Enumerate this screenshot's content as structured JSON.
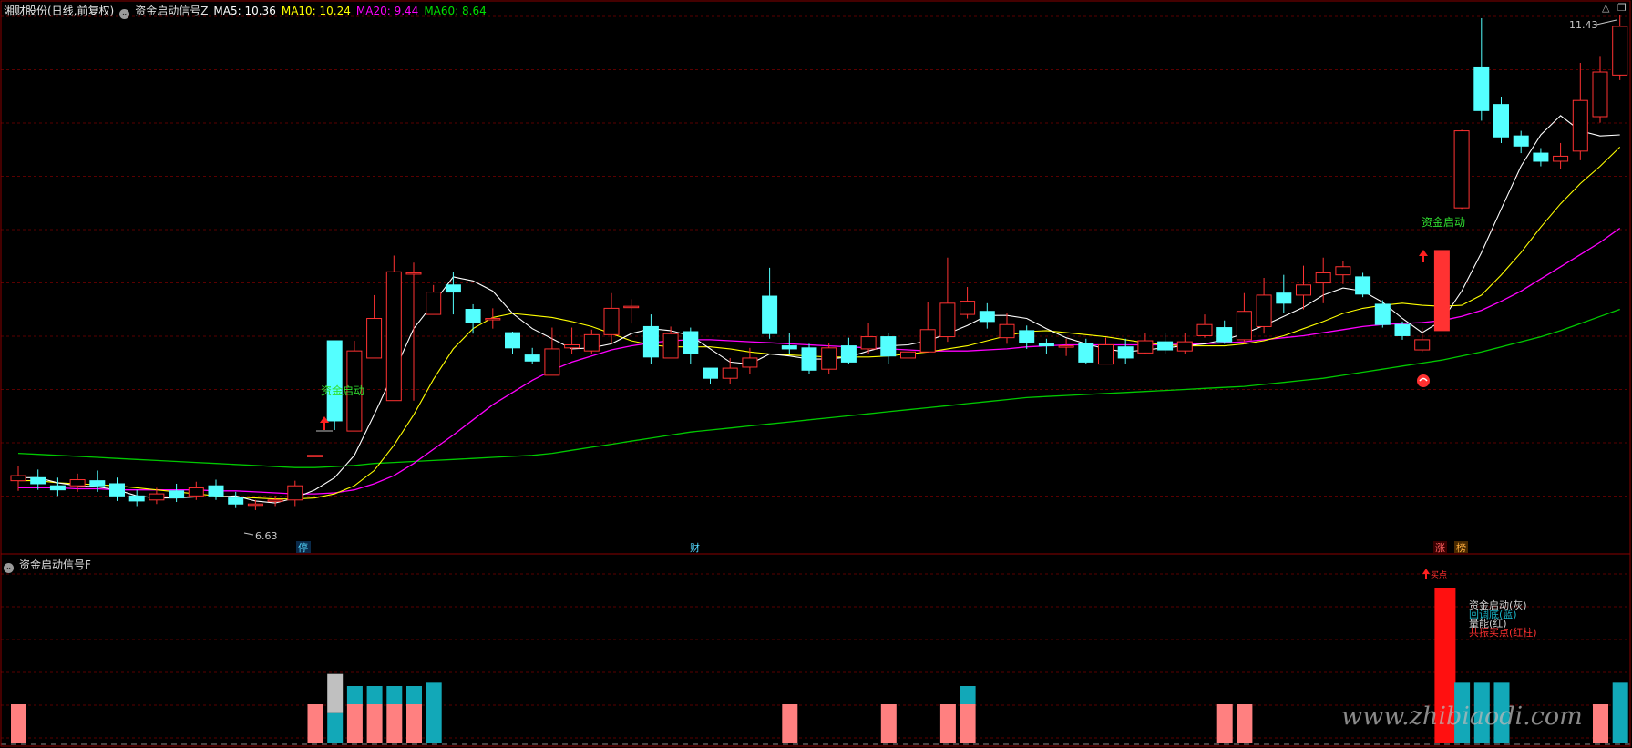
{
  "main_header": {
    "stock": "湘财股份(日线,前复权)",
    "indicator": "资金启动信号Z",
    "ma5": "MA5: 10.36",
    "ma10": "MA10: 10.24",
    "ma20": "MA20: 9.44",
    "ma60": "MA60: 8.64"
  },
  "sub_header": {
    "indicator": "资金启动信号F"
  },
  "price_labels": {
    "high": "11.43",
    "low": "6.63"
  },
  "markers": {
    "start_signal_1": "资金启动",
    "start_signal_2": "资金启动",
    "ting": "停",
    "cai": "财",
    "zhang": "涨",
    "bang": "榜",
    "buy_label": "买点"
  },
  "legend": [
    {
      "text": "资金启动(灰)",
      "color": "#d0d0d0"
    },
    {
      "text": "回调底(蓝)",
      "color": "#19b5c8"
    },
    {
      "text": "量能(红)",
      "color": "#d0d0d0"
    },
    {
      "text": "共振买点(红柱)",
      "color": "#ff3030"
    }
  ],
  "watermark": "www.zhibiaodi.com",
  "colors": {
    "up": "#ff3232",
    "down": "#54ffff",
    "ma5": "#ffffff",
    "ma10": "#ffff00",
    "ma20": "#ff00ff",
    "ma60": "#00c800",
    "grid": "#5a0000",
    "pink_bar": "#ff8080",
    "teal_bar": "#12a8b8",
    "gray_bar": "#c0c0c0"
  },
  "chart_data": {
    "type": "candlestick",
    "price_range": [
      6.3,
      11.6
    ],
    "candles": [
      [
        6.95,
        7.0,
        7.1,
        6.85
      ],
      [
        6.98,
        6.92,
        7.06,
        6.86
      ],
      [
        6.9,
        6.86,
        6.98,
        6.8
      ],
      [
        6.9,
        6.96,
        7.02,
        6.84
      ],
      [
        6.95,
        6.9,
        7.05,
        6.84
      ],
      [
        6.92,
        6.8,
        6.98,
        6.75
      ],
      [
        6.8,
        6.75,
        6.86,
        6.7
      ],
      [
        6.76,
        6.82,
        6.88,
        6.72
      ],
      [
        6.85,
        6.78,
        6.92,
        6.74
      ],
      [
        6.8,
        6.88,
        6.94,
        6.76
      ],
      [
        6.9,
        6.8,
        6.96,
        6.76
      ],
      [
        6.78,
        6.72,
        6.84,
        6.68
      ],
      [
        6.72,
        6.72,
        6.76,
        6.66
      ],
      [
        6.75,
        6.76,
        6.8,
        6.7
      ],
      [
        6.76,
        6.9,
        6.95,
        6.7
      ],
      [
        7.2,
        7.2,
        7.2,
        7.2
      ],
      [
        8.33,
        7.54,
        8.33,
        7.45
      ],
      [
        7.44,
        8.23,
        8.33,
        7.44
      ],
      [
        8.16,
        8.55,
        8.78,
        8.16
      ],
      [
        7.74,
        9.01,
        9.17,
        7.74
      ],
      [
        9.0,
        9.0,
        9.1,
        7.74
      ],
      [
        8.59,
        8.81,
        8.88,
        8.59
      ],
      [
        8.88,
        8.81,
        9.01,
        8.59
      ],
      [
        8.64,
        8.51,
        8.69,
        8.4
      ],
      [
        8.55,
        8.55,
        8.65,
        8.45
      ],
      [
        8.41,
        8.26,
        8.42,
        8.2
      ],
      [
        8.19,
        8.13,
        8.26,
        8.1
      ],
      [
        7.99,
        8.25,
        8.46,
        7.99
      ],
      [
        8.26,
        8.29,
        8.46,
        8.2
      ],
      [
        8.23,
        8.39,
        8.44,
        8.2
      ],
      [
        8.39,
        8.65,
        8.8,
        8.3
      ],
      [
        8.67,
        8.67,
        8.74,
        8.5
      ],
      [
        8.47,
        8.17,
        8.59,
        8.1
      ],
      [
        8.16,
        8.4,
        8.47,
        8.16
      ],
      [
        8.42,
        8.2,
        8.46,
        8.1
      ],
      [
        8.06,
        7.96,
        8.06,
        7.9
      ],
      [
        7.96,
        8.06,
        8.16,
        7.9
      ],
      [
        8.07,
        8.16,
        8.26,
        8.0
      ],
      [
        8.77,
        8.4,
        9.05,
        8.35
      ],
      [
        8.28,
        8.25,
        8.41,
        8.2
      ],
      [
        8.26,
        8.04,
        8.3,
        8.0
      ],
      [
        8.05,
        8.26,
        8.31,
        8.0
      ],
      [
        8.28,
        8.12,
        8.36,
        8.1
      ],
      [
        8.25,
        8.37,
        8.51,
        8.2
      ],
      [
        8.37,
        8.18,
        8.41,
        8.1
      ],
      [
        8.16,
        8.22,
        8.28,
        8.12
      ],
      [
        8.22,
        8.44,
        8.71,
        8.22
      ],
      [
        8.37,
        8.7,
        9.15,
        8.32
      ],
      [
        8.59,
        8.72,
        8.86,
        8.55
      ],
      [
        8.62,
        8.52,
        8.7,
        8.45
      ],
      [
        8.36,
        8.49,
        8.6,
        8.3
      ],
      [
        8.43,
        8.31,
        8.48,
        8.25
      ],
      [
        8.3,
        8.28,
        8.35,
        8.2
      ],
      [
        8.28,
        8.28,
        8.35,
        8.18
      ],
      [
        8.3,
        8.12,
        8.35,
        8.1
      ],
      [
        8.1,
        8.29,
        8.36,
        8.1
      ],
      [
        8.27,
        8.16,
        8.35,
        8.1
      ],
      [
        8.21,
        8.33,
        8.41,
        8.2
      ],
      [
        8.32,
        8.24,
        8.41,
        8.2
      ],
      [
        8.23,
        8.32,
        8.41,
        8.2
      ],
      [
        8.38,
        8.49,
        8.59,
        8.36
      ],
      [
        8.46,
        8.32,
        8.53,
        8.3
      ],
      [
        8.34,
        8.62,
        8.8,
        8.3
      ],
      [
        8.47,
        8.78,
        8.95,
        8.4
      ],
      [
        8.8,
        8.7,
        8.98,
        8.6
      ],
      [
        8.78,
        8.88,
        9.07,
        8.64
      ],
      [
        8.9,
        9.0,
        9.15,
        8.7
      ],
      [
        8.98,
        9.06,
        9.12,
        8.89
      ],
      [
        8.96,
        8.79,
        9.0,
        8.76
      ],
      [
        8.69,
        8.49,
        8.73,
        8.46
      ],
      [
        8.49,
        8.38,
        8.52,
        8.34
      ],
      [
        8.24,
        8.34,
        8.46,
        8.22
      ],
      [
        8.43,
        9.22,
        9.22,
        8.43
      ],
      [
        9.64,
        10.4,
        10.41,
        9.63
      ],
      [
        11.03,
        10.6,
        11.51,
        10.5
      ],
      [
        10.66,
        10.34,
        10.73,
        10.28
      ],
      [
        10.35,
        10.25,
        10.4,
        10.18
      ],
      [
        10.18,
        10.1,
        10.23,
        10.05
      ],
      [
        10.1,
        10.15,
        10.28,
        10.02
      ],
      [
        10.2,
        10.7,
        11.07,
        10.11
      ],
      [
        10.54,
        10.98,
        11.13,
        10.48
      ],
      [
        10.95,
        11.43,
        11.54,
        10.9
      ]
    ],
    "ma5": [
      6.98,
      6.98,
      6.93,
      6.9,
      6.89,
      6.86,
      6.8,
      6.78,
      6.78,
      6.79,
      6.79,
      6.8,
      6.75,
      6.73,
      6.78,
      6.86,
      6.98,
      7.2,
      7.6,
      8.02,
      8.45,
      8.7,
      8.96,
      8.92,
      8.82,
      8.6,
      8.45,
      8.35,
      8.25,
      8.26,
      8.3,
      8.4,
      8.45,
      8.43,
      8.38,
      8.25,
      8.12,
      8.1,
      8.2,
      8.18,
      8.15,
      8.15,
      8.17,
      8.23,
      8.28,
      8.29,
      8.33,
      8.4,
      8.48,
      8.58,
      8.58,
      8.55,
      8.45,
      8.36,
      8.3,
      8.25,
      8.22,
      8.24,
      8.26,
      8.28,
      8.3,
      8.34,
      8.4,
      8.48,
      8.57,
      8.66,
      8.78,
      8.85,
      8.82,
      8.71,
      8.55,
      8.41,
      8.53,
      8.82,
      9.2,
      9.63,
      10.05,
      10.36,
      10.55,
      10.4,
      10.35,
      10.36
    ],
    "ma10": [
      6.95,
      6.95,
      6.93,
      6.92,
      6.91,
      6.9,
      6.88,
      6.86,
      6.84,
      6.82,
      6.8,
      6.79,
      6.78,
      6.77,
      6.77,
      6.78,
      6.82,
      6.9,
      7.05,
      7.3,
      7.6,
      7.95,
      8.25,
      8.45,
      8.56,
      8.6,
      8.58,
      8.56,
      8.52,
      8.47,
      8.4,
      8.33,
      8.29,
      8.27,
      8.27,
      8.27,
      8.25,
      8.22,
      8.2,
      8.19,
      8.18,
      8.17,
      8.17,
      8.17,
      8.18,
      8.2,
      8.22,
      8.25,
      8.28,
      8.33,
      8.38,
      8.42,
      8.43,
      8.41,
      8.39,
      8.37,
      8.34,
      8.31,
      8.29,
      8.28,
      8.28,
      8.28,
      8.3,
      8.33,
      8.38,
      8.45,
      8.52,
      8.6,
      8.65,
      8.68,
      8.7,
      8.68,
      8.67,
      8.68,
      8.78,
      8.98,
      9.2,
      9.45,
      9.68,
      9.88,
      10.05,
      10.24
    ],
    "ma20": [
      6.88,
      6.88,
      6.88,
      6.87,
      6.87,
      6.86,
      6.86,
      6.86,
      6.86,
      6.86,
      6.85,
      6.85,
      6.84,
      6.83,
      6.82,
      6.82,
      6.83,
      6.86,
      6.92,
      7.0,
      7.12,
      7.26,
      7.4,
      7.55,
      7.7,
      7.82,
      7.94,
      8.04,
      8.12,
      8.18,
      8.24,
      8.28,
      8.31,
      8.33,
      8.34,
      8.34,
      8.33,
      8.32,
      8.31,
      8.3,
      8.29,
      8.28,
      8.27,
      8.26,
      8.25,
      8.24,
      8.23,
      8.23,
      8.23,
      8.24,
      8.25,
      8.27,
      8.28,
      8.29,
      8.29,
      8.29,
      8.29,
      8.29,
      8.29,
      8.3,
      8.3,
      8.31,
      8.32,
      8.34,
      8.36,
      8.38,
      8.41,
      8.44,
      8.47,
      8.49,
      8.5,
      8.51,
      8.53,
      8.57,
      8.63,
      8.72,
      8.82,
      8.94,
      9.06,
      9.18,
      9.3,
      9.44
    ],
    "ma60": [
      7.22,
      7.21,
      7.2,
      7.19,
      7.18,
      7.17,
      7.16,
      7.15,
      7.14,
      7.13,
      7.12,
      7.11,
      7.1,
      7.09,
      7.08,
      7.08,
      7.09,
      7.1,
      7.12,
      7.13,
      7.14,
      7.15,
      7.16,
      7.17,
      7.18,
      7.19,
      7.2,
      7.22,
      7.25,
      7.28,
      7.31,
      7.34,
      7.37,
      7.4,
      7.43,
      7.45,
      7.47,
      7.49,
      7.51,
      7.53,
      7.55,
      7.57,
      7.59,
      7.61,
      7.63,
      7.65,
      7.67,
      7.69,
      7.71,
      7.73,
      7.75,
      7.77,
      7.78,
      7.79,
      7.8,
      7.81,
      7.82,
      7.83,
      7.84,
      7.85,
      7.86,
      7.87,
      7.88,
      7.9,
      7.92,
      7.94,
      7.96,
      7.99,
      8.02,
      8.05,
      8.08,
      8.11,
      8.14,
      8.18,
      8.22,
      8.27,
      8.32,
      8.37,
      8.43,
      8.5,
      8.57,
      8.64
    ],
    "sub_bars": [
      {
        "i": 0,
        "pink": 1
      },
      {
        "i": 15,
        "pink": 1,
        "teal": 0
      },
      {
        "i": 16,
        "teal": 1,
        "gray": 1
      },
      {
        "i": 17,
        "pink": 1,
        "teal": 1
      },
      {
        "i": 18,
        "pink": 1,
        "teal": 1
      },
      {
        "i": 19,
        "pink": 1,
        "teal": 1
      },
      {
        "i": 20,
        "pink": 1,
        "teal": 1
      },
      {
        "i": 21,
        "teal": 2
      },
      {
        "i": 39,
        "pink": 1
      },
      {
        "i": 44,
        "pink": 1
      },
      {
        "i": 47,
        "pink": 1
      },
      {
        "i": 48,
        "pink": 1,
        "teal": 1
      },
      {
        "i": 61,
        "pink": 1
      },
      {
        "i": 62,
        "pink": 1
      },
      {
        "i": 72,
        "red": 1
      },
      {
        "i": 73,
        "teal": 2
      },
      {
        "i": 74,
        "teal": 2
      },
      {
        "i": 75,
        "teal": 2
      },
      {
        "i": 80,
        "pink": 1
      },
      {
        "i": 81,
        "teal": 2
      }
    ]
  }
}
